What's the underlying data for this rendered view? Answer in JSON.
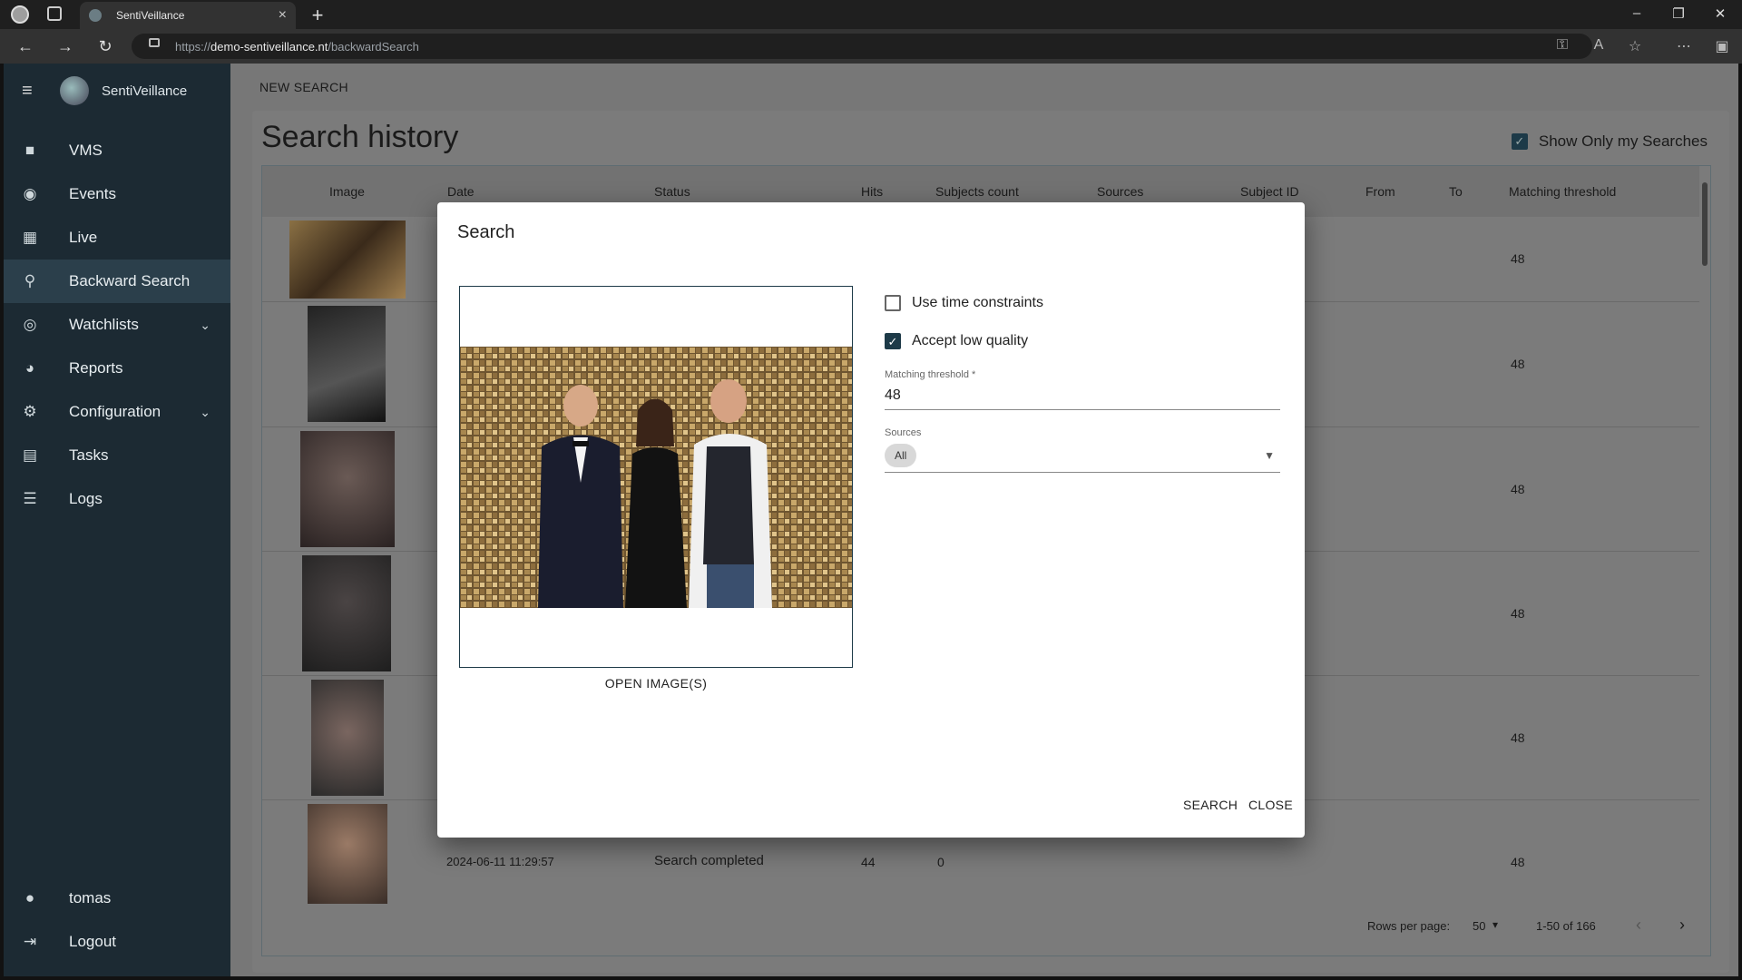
{
  "browser": {
    "tab_title": "SentiVeillance",
    "url_prefix": "https://",
    "url_host": "demo-sentiveillance.nt",
    "url_path": "/backwardSearch"
  },
  "sidebar": {
    "brand": "SentiVeillance",
    "items": [
      {
        "label": "VMS",
        "icon": "camera-icon"
      },
      {
        "label": "Events",
        "icon": "aperture-icon"
      },
      {
        "label": "Live",
        "icon": "dashboard-icon"
      },
      {
        "label": "Backward Search",
        "icon": "search-icon"
      },
      {
        "label": "Watchlists",
        "icon": "eye-icon"
      },
      {
        "label": "Reports",
        "icon": "pie-chart-icon"
      },
      {
        "label": "Configuration",
        "icon": "gear-icon"
      },
      {
        "label": "Tasks",
        "icon": "clipboard-icon"
      },
      {
        "label": "Logs",
        "icon": "list-icon"
      }
    ],
    "user": "tomas",
    "logout": "Logout"
  },
  "main": {
    "new_search": "NEW SEARCH",
    "title": "Search history",
    "show_only_mine": "Show Only my Searches",
    "columns": [
      "Image",
      "Date",
      "Status",
      "Hits",
      "Subjects count",
      "Sources",
      "Subject ID",
      "From",
      "To",
      "Matching threshold"
    ],
    "rows": [
      {
        "threshold": "48"
      },
      {
        "threshold": "48"
      },
      {
        "threshold": "48"
      },
      {
        "threshold": "48"
      },
      {
        "threshold": "48"
      },
      {
        "date": "2024-06-11 11:29:57",
        "status": "Search completed",
        "hits": "44",
        "subjects": "0",
        "threshold": "48"
      }
    ],
    "rows_per_page_label": "Rows per page:",
    "rows_per_page": "50",
    "range": "1-50 of 166"
  },
  "dialog": {
    "title": "Search",
    "open_images": "OPEN IMAGE(S)",
    "use_time_constraints": "Use time constraints",
    "use_time_constraints_checked": false,
    "accept_low_quality": "Accept low quality",
    "accept_low_quality_checked": true,
    "threshold_label": "Matching threshold *",
    "threshold_value": "48",
    "sources_label": "Sources",
    "sources_value": "All",
    "search_button": "SEARCH",
    "close_button": "CLOSE"
  }
}
